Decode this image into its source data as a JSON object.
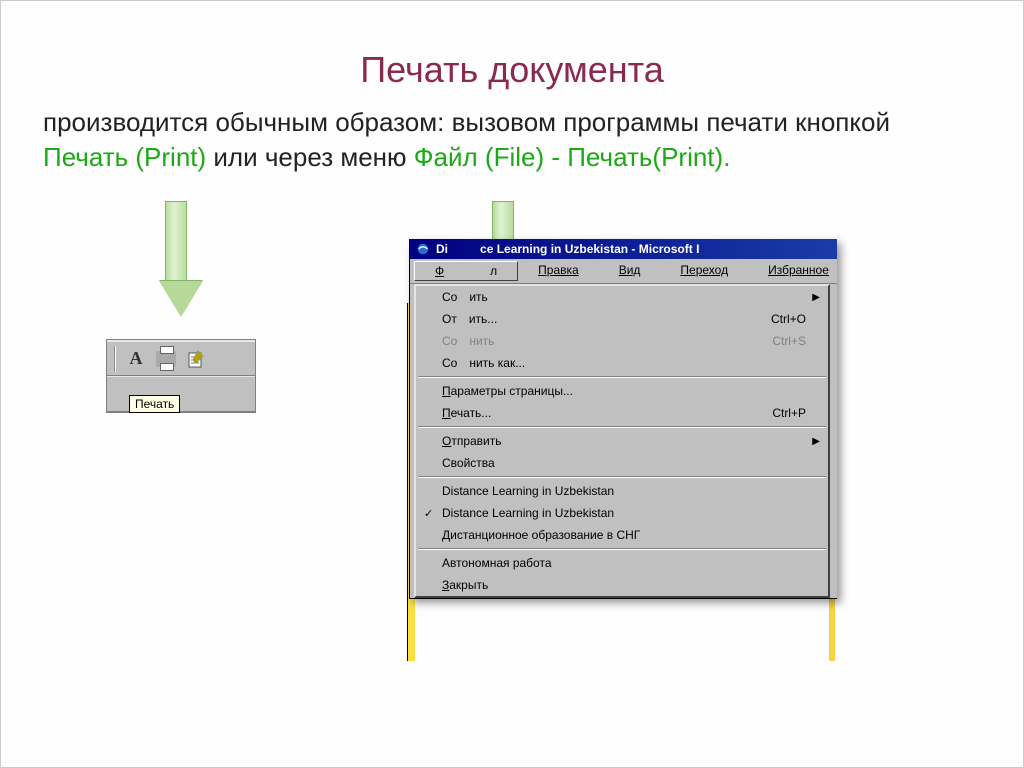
{
  "title": "Печать документа",
  "para": {
    "line1": "производится обычным образом: вызовом программы печати кнопкой",
    "print_link": "Печать (Print)",
    "mid": " или через меню ",
    "file_link": "Файл (File) - Печать(Print).",
    "tail": ""
  },
  "toolbar": {
    "tooltip": "Печать"
  },
  "ie": {
    "title_prefix": "Di",
    "title_suffix": "ce Learning in Uzbekistan - Microsoft I",
    "menubar": {
      "file_pre": "Ф",
      "file_post": "л",
      "edit": "Правка",
      "view": "Вид",
      "go": "Переход",
      "fav": "Избранное"
    },
    "menu": {
      "create_pre": "Со",
      "create_post": "ить",
      "open_pre": "От",
      "open_post": "ить...",
      "open_sc": "Ctrl+O",
      "save_pre": "Со",
      "save_post": "нить",
      "save_sc": "Ctrl+S",
      "saveas_pre": "Сo",
      "saveas_post": "нить как...",
      "page_setup": "Параметры страницы...",
      "print": "Печать...",
      "print_sc": "Ctrl+P",
      "send": "Отправить",
      "props": "Свойства",
      "recent1": "Distance Learning in Uzbekistan",
      "recent2": "Distance Learning in Uzbekistan",
      "recent3": "Дистанционное образование в СНГ",
      "offline": "Автономная работа",
      "close": "Закрыть"
    }
  }
}
